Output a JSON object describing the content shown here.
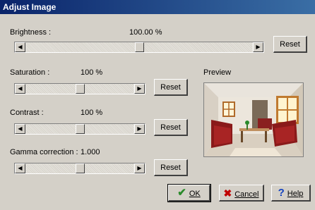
{
  "window": {
    "title": "Adjust Image"
  },
  "brightness": {
    "label": "Brightness :",
    "value": "100.00 %",
    "level": 0.5,
    "reset": "Reset"
  },
  "saturation": {
    "label": "Saturation :",
    "value": "100 %",
    "level": 0.5,
    "reset": "Reset"
  },
  "contrast": {
    "label": "Contrast :",
    "value": "100 %",
    "level": 0.5,
    "reset": "Reset"
  },
  "gamma": {
    "label": "Gamma correction :",
    "value": "1.000",
    "level": 0.5,
    "reset": "Reset"
  },
  "preview": {
    "label": "Preview"
  },
  "buttons": {
    "ok": "OK",
    "cancel": "Cancel",
    "help": "Help"
  },
  "icons": {
    "left": "arrow-left-icon",
    "right": "arrow-right-icon",
    "ok": "checkmark-icon",
    "cancel": "x-icon",
    "help": "question-icon"
  },
  "colors": {
    "title_start": "#0a246a",
    "title_end": "#3a6ea5",
    "ok_icon": "#2a8a2a",
    "cancel_icon": "#c00000",
    "help_icon": "#1040c0"
  }
}
